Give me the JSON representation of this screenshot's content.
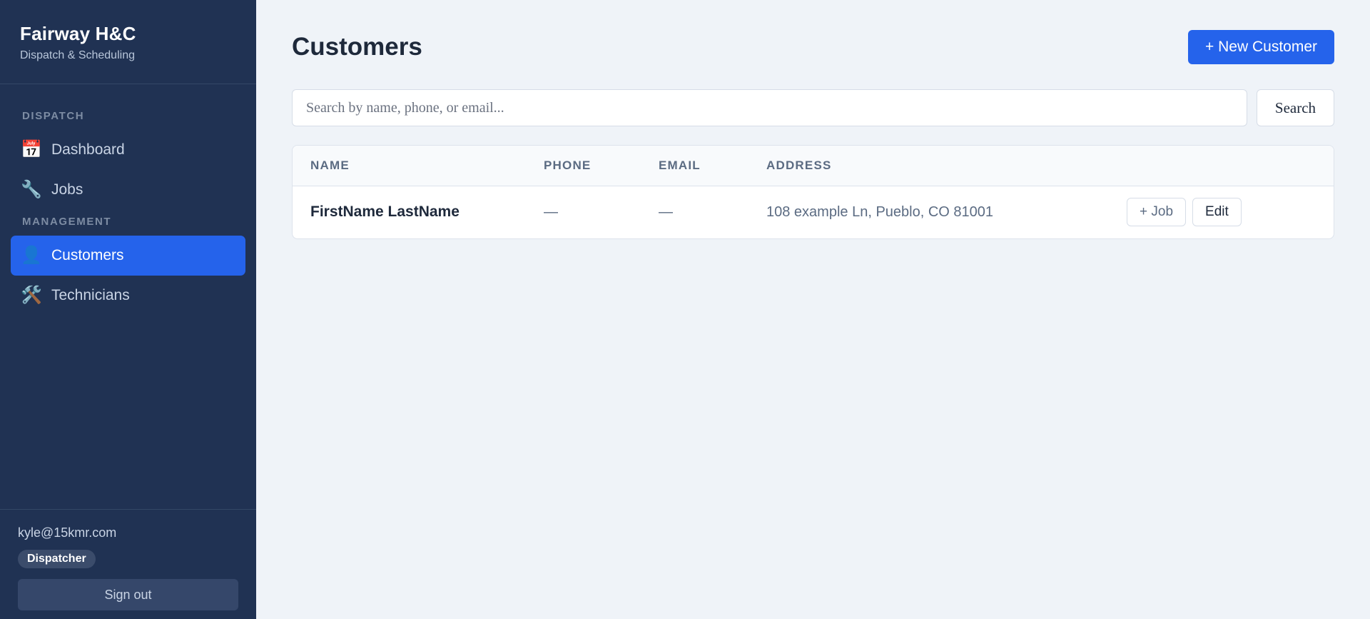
{
  "brand": {
    "title": "Fairway H&C",
    "subtitle": "Dispatch & Scheduling"
  },
  "nav": {
    "dispatch_label": "DISPATCH",
    "management_label": "MANAGEMENT",
    "items": [
      {
        "label": "Dashboard",
        "icon": "calendar-icon",
        "glyph": "📅",
        "active": false
      },
      {
        "label": "Jobs",
        "icon": "wrench-icon",
        "glyph": "🔧",
        "active": false
      },
      {
        "label": "Customers",
        "icon": "person-icon",
        "glyph": "👤",
        "active": true
      },
      {
        "label": "Technicians",
        "icon": "tools-icon",
        "glyph": "🛠️",
        "active": false
      }
    ]
  },
  "user": {
    "email": "kyle@15kmr.com",
    "role": "Dispatcher",
    "signout_label": "Sign out"
  },
  "page": {
    "title": "Customers",
    "new_button_label": "+ New Customer"
  },
  "search": {
    "value": "",
    "placeholder": "Search by name, phone, or email...",
    "button_label": "Search"
  },
  "table": {
    "columns": [
      "NAME",
      "PHONE",
      "EMAIL",
      "ADDRESS",
      ""
    ],
    "rows": [
      {
        "name": "FirstName LastName",
        "phone": "—",
        "email": "—",
        "address": "108 example Ln, Pueblo, CO 81001",
        "job_button": "+ Job",
        "edit_button": "Edit"
      }
    ]
  },
  "colors": {
    "sidebar_bg": "#203253",
    "accent": "#2563eb",
    "page_bg": "#eff3f8"
  }
}
